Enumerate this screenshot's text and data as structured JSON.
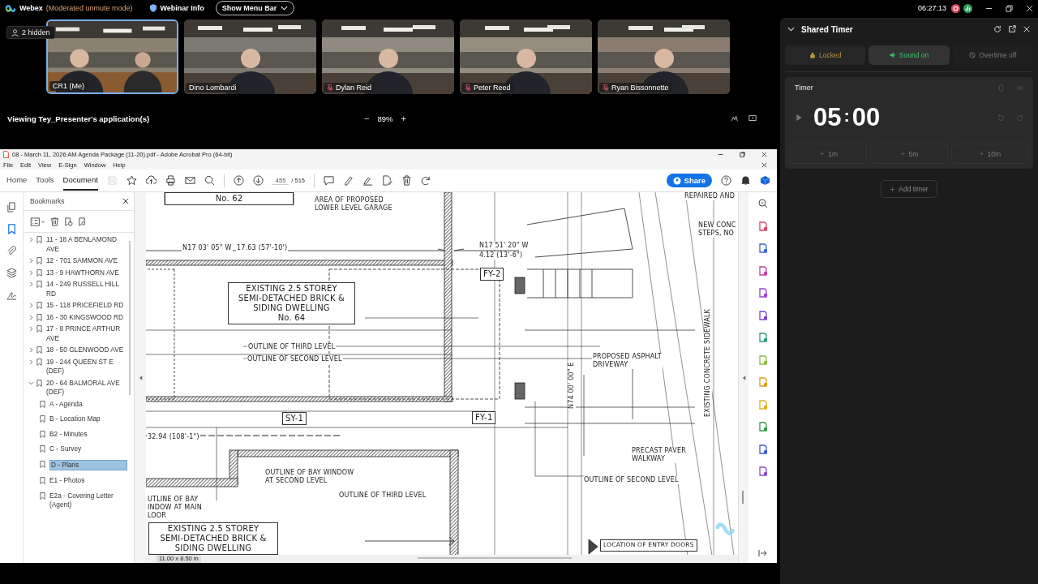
{
  "app_bar": {
    "title": "Webex",
    "mode": "(Moderated unmute mode)",
    "info": "Webinar Info",
    "menu_button": "Show Menu Bar",
    "clock": "06:27:13"
  },
  "hidden_count": "2 hidden",
  "participants": [
    {
      "name": "CR1 (Me)",
      "muted": false,
      "selected": true
    },
    {
      "name": "Dino Lombardi",
      "muted": false,
      "selected": false
    },
    {
      "name": "Dylan Reid",
      "muted": true,
      "selected": false
    },
    {
      "name": "Peter Reed",
      "muted": true,
      "selected": false
    },
    {
      "name": "Ryan Bissonnette",
      "muted": true,
      "selected": false
    }
  ],
  "share_bar": {
    "viewing": "Viewing Tey_Presenter's application(s)",
    "zoom_out": "−",
    "zoom": "89%",
    "zoom_in": "+"
  },
  "acrobat": {
    "title": "08 - March 11, 2026 AM Agenda Package (11-20).pdf - Adobe Acrobat Pro (64-bit)",
    "menu": [
      "File",
      "Edit",
      "View",
      "E-Sign",
      "Window",
      "Help"
    ],
    "tabs": [
      {
        "label": "Home",
        "selected": false
      },
      {
        "label": "Tools",
        "selected": false
      },
      {
        "label": "Document",
        "selected": true
      }
    ],
    "page": "455",
    "pages": "/ 515",
    "share": "Share",
    "bookmarks_title": "Bookmarks",
    "bookmarks": [
      {
        "label": "11 - 18 A BENLAMOND AVE",
        "expanded": false,
        "selected": false
      },
      {
        "label": "12 - 701 SAMMON AVE",
        "expanded": false,
        "selected": false
      },
      {
        "label": "13 - 9 HAWTHORN AVE",
        "expanded": false,
        "selected": false
      },
      {
        "label": "14 - 249 RUSSELL HILL RD",
        "expanded": false,
        "selected": false
      },
      {
        "label": "15 - 118 PRICEFIELD RD",
        "expanded": false,
        "selected": false
      },
      {
        "label": "16 - 30 KINGSWOOD RD",
        "expanded": false,
        "selected": false
      },
      {
        "label": "17 - 8 PRINCE ARTHUR AVE",
        "expanded": false,
        "selected": false
      },
      {
        "label": "18 - 50 GLENWOOD AVE",
        "expanded": false,
        "selected": false
      },
      {
        "label": "19 - 244 QUEEN ST E (DEF)",
        "expanded": false,
        "selected": false
      },
      {
        "label": "20 - 64 BALMORAL AVE (DEF)",
        "expanded": true,
        "selected": false,
        "children": [
          {
            "label": "A - Agenda",
            "selected": false
          },
          {
            "label": "B - Location Map",
            "selected": false
          },
          {
            "label": "B2 - Minutes",
            "selected": false
          },
          {
            "label": "C - Survey",
            "selected": false
          },
          {
            "label": "D - Plans",
            "selected": true
          },
          {
            "label": "E1 - Photos",
            "selected": false
          },
          {
            "label": "E2a - Covering Letter (Agent)",
            "selected": false
          }
        ]
      }
    ],
    "drawing_labels": [
      {
        "kind": "boxed",
        "text": "No. 62"
      },
      {
        "kind": "note",
        "text": "AREA OF PROPOSED\nLOWER LEVEL GARAGE"
      },
      {
        "kind": "note",
        "text": "N17 03' 05\" W"
      },
      {
        "kind": "note",
        "text": "17.63 (57'-10')"
      },
      {
        "kind": "boxed",
        "text": "EXISTING 2.5 STOREY\nSEMI-DETACHED BRICK &\nSIDING DWELLING\nNo. 64"
      },
      {
        "kind": "note",
        "text": "OUTLINE OF THIRD LEVEL"
      },
      {
        "kind": "note",
        "text": "OUTLINE OF SECOND LEVEL"
      },
      {
        "kind": "note",
        "text": "N17 51' 20\" W"
      },
      {
        "kind": "note",
        "text": "4.12 (13'-6\")"
      },
      {
        "kind": "note",
        "text": "REPAIRED AND"
      },
      {
        "kind": "note",
        "text": "NEW CONC\nSTEPS, NO"
      },
      {
        "kind": "boxed",
        "text": "FY-2"
      },
      {
        "kind": "note",
        "text": "PROPOSED ASPHALT\nDRIVEWAY"
      },
      {
        "kind": "vertical",
        "text": "N74 00' 00\" E"
      },
      {
        "kind": "vertical",
        "text": "EXISTING CONCRETE SIDEWALK"
      },
      {
        "kind": "boxed",
        "text": "SY-1"
      },
      {
        "kind": "boxed",
        "text": "FY-1"
      },
      {
        "kind": "note",
        "text": "32.94 (108'-1\")"
      },
      {
        "kind": "note",
        "text": "PRECAST PAVER\nWALKWAY"
      },
      {
        "kind": "note",
        "text": "OUTLINE OF BAY WINDOW\nAT SECOND LEVEL"
      },
      {
        "kind": "note",
        "text": "OUTLINE OF THIRD LEVEL"
      },
      {
        "kind": "note",
        "text": "OUTLINE OF SECOND LEVEL"
      },
      {
        "kind": "note",
        "text": "UTLINE OF BAY\nINDOW AT MAIN\nLOOR"
      },
      {
        "kind": "boxed",
        "text": "EXISTING 2.5 STOREY\nSEMI-DETACHED BRICK &\nSIDING DWELLING"
      },
      {
        "kind": "boxed",
        "text": "LOCATION OF ENTRY DOORS"
      }
    ],
    "page_size": "11.00 x 8.50 in"
  },
  "timer": {
    "title": "Shared Timer",
    "toggles": [
      {
        "kind": "lock",
        "label": "Locked",
        "on": true
      },
      {
        "kind": "sound",
        "label": "Sound on",
        "on": true
      },
      {
        "kind": "overtime",
        "label": "Overtime off",
        "on": false
      }
    ],
    "card_title": "Timer",
    "minutes": "05",
    "separator": ":",
    "seconds": "00",
    "increments": [
      "1m",
      "5m",
      "10m"
    ],
    "add_label": "Add timer"
  }
}
